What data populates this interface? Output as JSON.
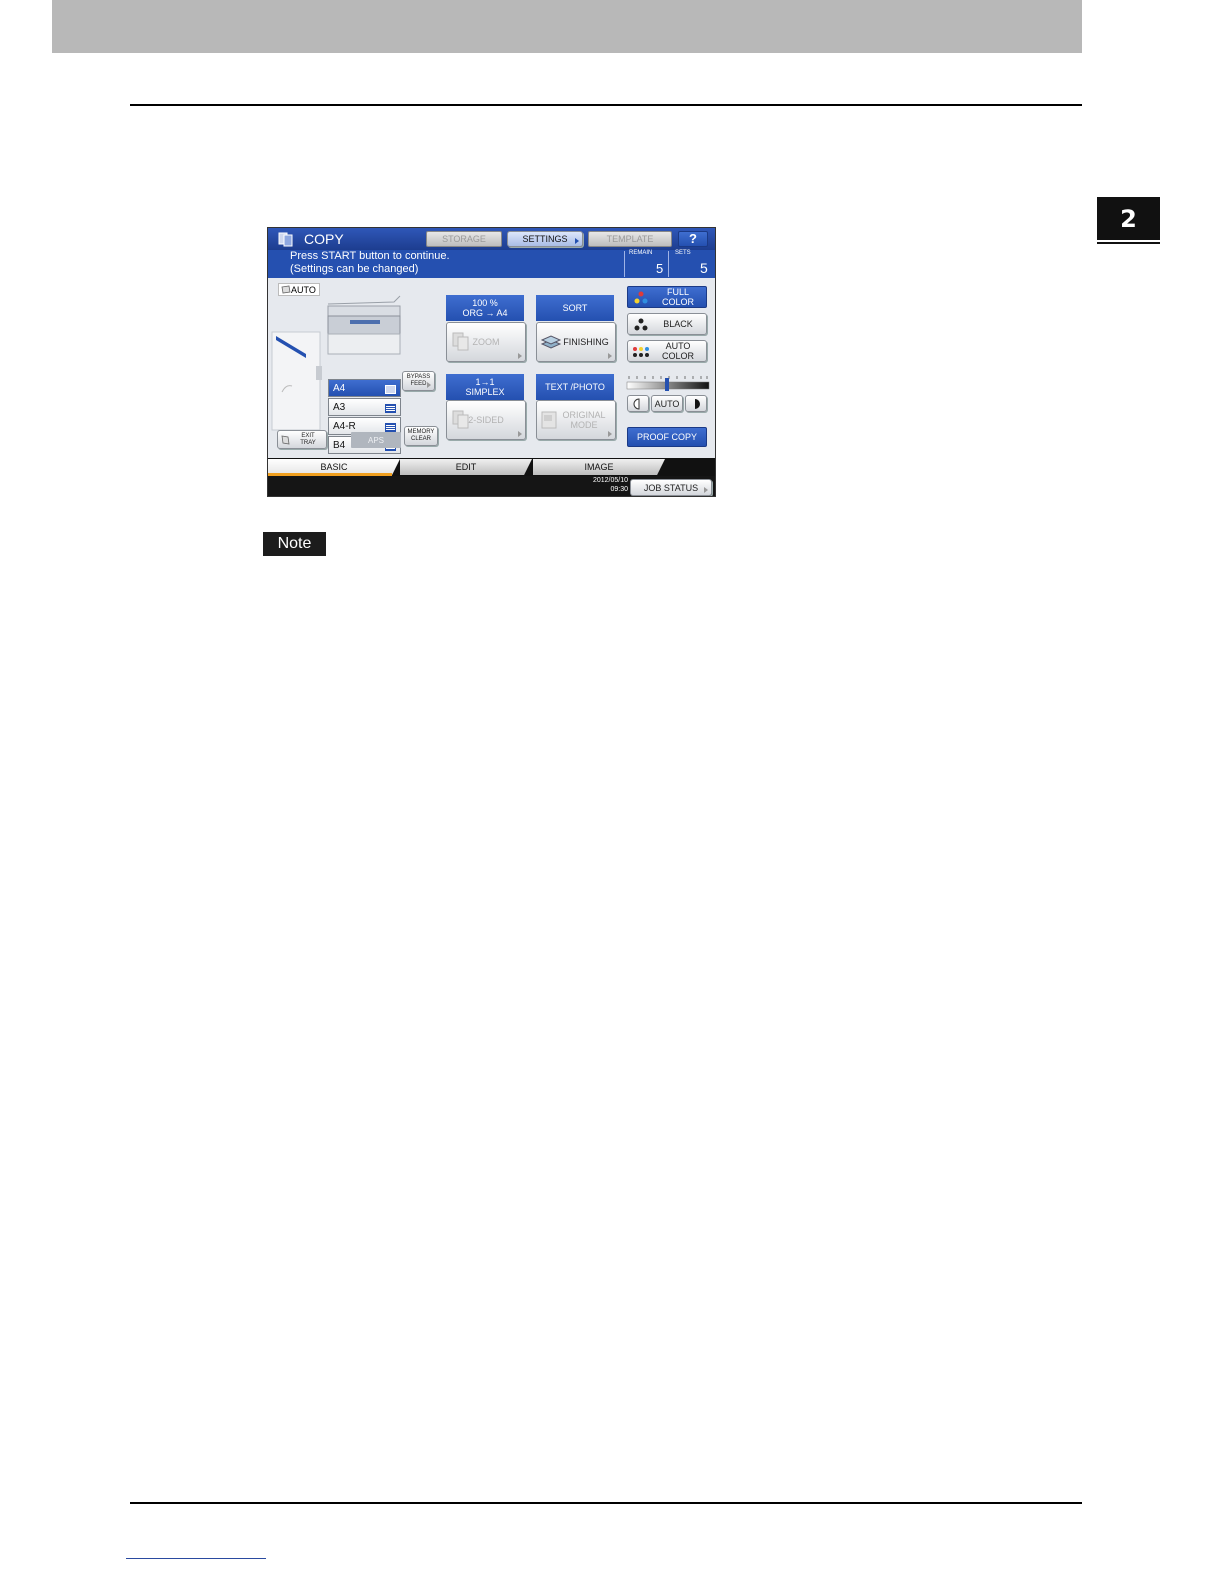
{
  "page": {
    "chapter_number": "2",
    "note_label": "Note"
  },
  "copier": {
    "title": "COPY",
    "top_buttons": {
      "storage": "STORAGE",
      "settings": "SETTINGS",
      "template": "TEMPLATE",
      "help": "?"
    },
    "message_line1": "Press START button to continue.",
    "message_line2": "(Settings can be changed)",
    "remain_label": "REMAIN",
    "remain_value": "5",
    "sets_label": "SETS",
    "sets_value": "5",
    "auto_badge": "AUTO",
    "trays": [
      "A4",
      "A3",
      "A4-R",
      "B4"
    ],
    "selected_tray": "A4",
    "bypass_feed": [
      "BYPASS",
      "FEED"
    ],
    "exit_tray": [
      "EXIT",
      "TRAY"
    ],
    "aps": "APS",
    "memory_clear": [
      "MEMORY",
      "CLEAR"
    ],
    "zoom": {
      "header_line1": "100 %",
      "header_line2": "ORG   →   A4",
      "button": "ZOOM"
    },
    "finishing": {
      "header": "SORT",
      "button": "FINISHING"
    },
    "duplex": {
      "header_line1": "1→1",
      "header_line2": "SIMPLEX",
      "button": "2-SIDED"
    },
    "original_mode": {
      "header": "TEXT /PHOTO",
      "button_line1": "ORIGINAL",
      "button_line2": "MODE"
    },
    "color_modes": {
      "full_color": [
        "FULL",
        "COLOR"
      ],
      "black": "BLACK",
      "auto_color": [
        "AUTO",
        "COLOR"
      ]
    },
    "density_auto": "AUTO",
    "proof_copy": "PROOF COPY",
    "tabs": [
      "BASIC",
      "EDIT",
      "IMAGE"
    ],
    "active_tab": "BASIC",
    "date": "2012/05/10",
    "time": "09:30",
    "job_status": "JOB STATUS",
    "colors": {
      "accent_blue": "#2550b0",
      "tab_active_underline": "#f0a020"
    }
  }
}
